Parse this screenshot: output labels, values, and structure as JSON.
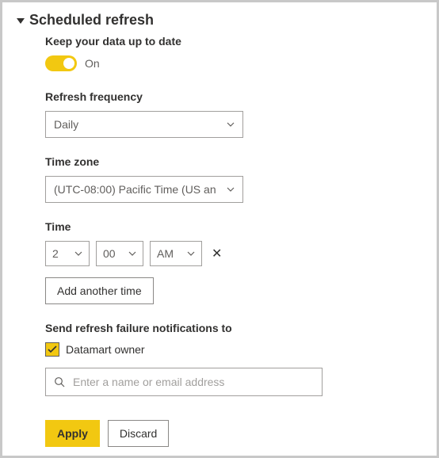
{
  "section": {
    "title": "Scheduled refresh"
  },
  "keepUpToDate": {
    "label": "Keep your data up to date",
    "toggleState": "On"
  },
  "frequency": {
    "label": "Refresh frequency",
    "value": "Daily"
  },
  "timezone": {
    "label": "Time zone",
    "value": "(UTC-08:00) Pacific Time (US an"
  },
  "time": {
    "label": "Time",
    "hour": "2",
    "minute": "00",
    "ampm": "AM",
    "addAnother": "Add another time"
  },
  "notify": {
    "label": "Send refresh failure notifications to",
    "ownerLabel": "Datamart owner",
    "placeholder": "Enter a name or email address"
  },
  "footer": {
    "apply": "Apply",
    "discard": "Discard"
  }
}
